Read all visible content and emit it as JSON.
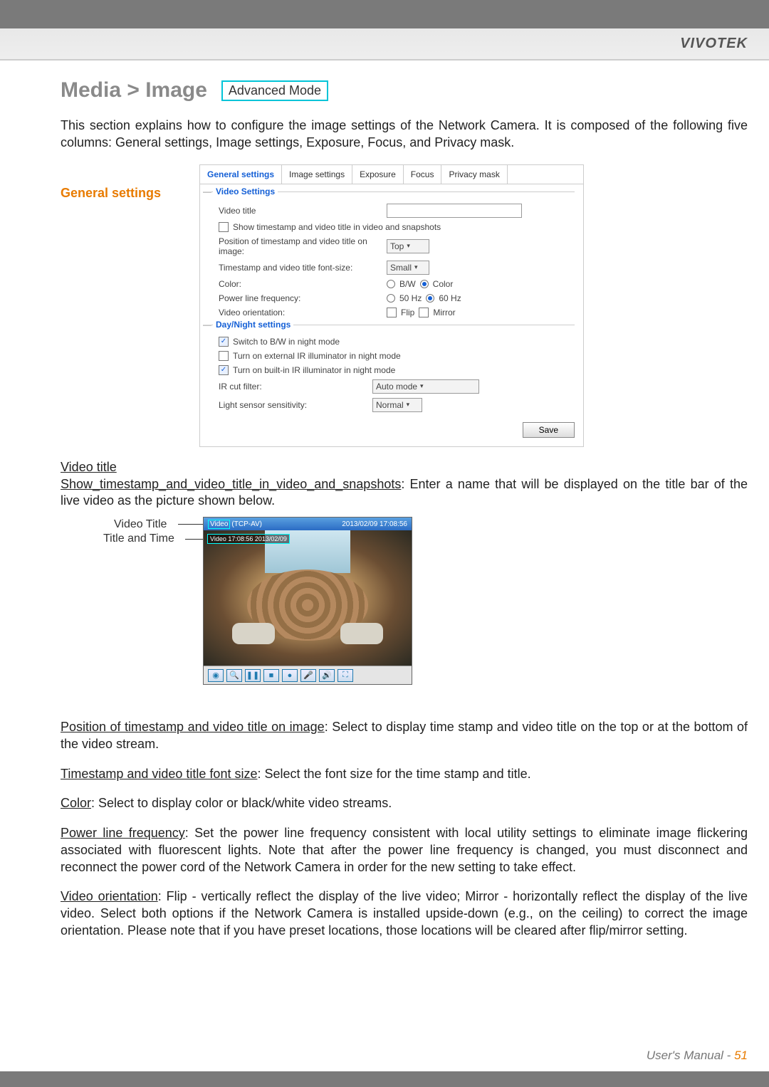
{
  "brand": "VIVOTEK",
  "title": {
    "breadcrumb": "Media > Image",
    "mode_badge": "Advanced Mode"
  },
  "intro": "This section explains how to configure the image settings of the Network Camera. It is composed of the following five columns: General settings, Image settings, Exposure, Focus, and Privacy mask.",
  "side_heading": "General settings",
  "tabs": {
    "t0": "General settings",
    "t1": "Image settings",
    "t2": "Exposure",
    "t3": "Focus",
    "t4": "Privacy mask"
  },
  "video_settings": {
    "group": "Video Settings",
    "video_title": "Video title",
    "show_ts": "Show timestamp and video title in video and snapshots",
    "pos_label": "Position of timestamp and video title on image:",
    "pos_value": "Top",
    "font_label": "Timestamp and video title font-size:",
    "font_value": "Small",
    "color_label": "Color:",
    "bw": "B/W",
    "color": "Color",
    "plf_label": "Power line frequency:",
    "plf_50": "50 Hz",
    "plf_60": "60 Hz",
    "orient_label": "Video orientation:",
    "flip": "Flip",
    "mirror": "Mirror"
  },
  "daynight": {
    "group": "Day/Night settings",
    "switch_bw": "Switch to B/W in night mode",
    "ext_ir": "Turn on external IR illuminator in night mode",
    "builtin_ir": "Turn on built-in IR illuminator in night mode",
    "ircut_label": "IR cut filter:",
    "ircut_value": "Auto mode",
    "sens_label": "Light sensor sensitivity:",
    "sens_value": "Normal"
  },
  "save": "Save",
  "sections": {
    "video_title_h": "Video title",
    "show_ts_run": "Show_timestamp_and_video_title_in_video_and_snapshots",
    "show_ts_text": ": Enter a name that will be displayed on the title bar of the live video as the picture shown below.",
    "preview": {
      "callout_title": "Video Title",
      "callout_time": "Title and Time",
      "bar_title_left": "Video",
      "bar_title_codec": "(TCP-AV)",
      "bar_title_right": "2013/02/09 17:08:56",
      "overlay": "Video 17:08:56 2013/02/09"
    },
    "pos_run": "Position of timestamp and video title on image",
    "pos_text": ": Select to display time stamp and video title on the top or at the bottom of the video stream.",
    "font_run": "Timestamp and video title font size",
    "font_text": ": Select the font size for the time stamp and title.",
    "color_run": "Color",
    "color_text": ": Select to display color or black/white video streams.",
    "plf_run": "Power line frequency",
    "plf_text": ": Set the power line frequency consistent with local utility settings to eliminate image flickering associated with fluorescent lights. Note that after the power line frequency is changed, you must disconnect and reconnect the power cord of the Network Camera in order for the new setting to take effect.",
    "orient_run": "Video orientation",
    "orient_text": ": Flip - vertically reflect the display of the live video; Mirror - horizontally reflect the display of the live video. Select both options if the Network Camera is installed upside-down (e.g., on the ceiling) to correct the image orientation. Please note that if you have preset locations, those locations will be cleared after flip/mirror setting."
  },
  "footer": {
    "label": "User's Manual - ",
    "page": "51"
  }
}
